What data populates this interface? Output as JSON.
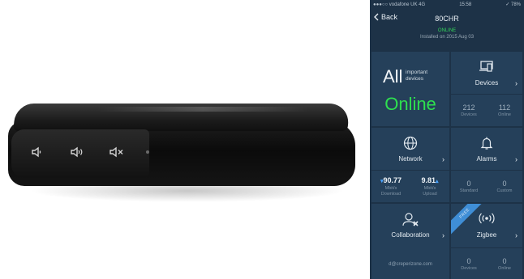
{
  "phone": {
    "status_bar": {
      "carrier": "●●●○○ vodafone UK  4G",
      "time": "15:58",
      "battery": "✓ 78%"
    },
    "nav": {
      "back_label": "Back",
      "title": "80CHR"
    },
    "status": {
      "state": "ONLINE",
      "installed": "Installed on 2015 Aug 03"
    },
    "summary": {
      "all": "All",
      "important_line1": "important",
      "important_line2": "devices",
      "online": "Online"
    },
    "devices": {
      "title": "Devices",
      "count_a": "212",
      "label_a": "Devices",
      "count_b": "112",
      "label_b": "Online"
    },
    "network": {
      "title": "Network",
      "down_val": "90.77",
      "down_label_1": "Mbit/s",
      "down_label_2": "Download",
      "up_val": "9.81",
      "up_label_1": "Mbit/s",
      "up_label_2": "Upload"
    },
    "alarms": {
      "title": "Alarms",
      "count_a": "0",
      "label_a": "Standard",
      "count_b": "0",
      "label_b": "Custom"
    },
    "collaboration": {
      "title": "Collaboration",
      "email": "d@creperizone.com",
      "ribbon": "FREE"
    },
    "zigbee": {
      "title": "Zigbee",
      "count_a": "0",
      "label_a": "Devices",
      "count_b": "0",
      "label_b": "Online"
    },
    "chevron": "›"
  },
  "colors": {
    "bg": "#1d3247",
    "tile": "#25405a",
    "online_green": "#2ee04f",
    "ribbon_blue": "#3f8ed6"
  },
  "icons": [
    "speaker-icon",
    "volume-icon",
    "mute-icon",
    "devices-icon",
    "globe-icon",
    "bell-icon",
    "collaboration-icon",
    "zigbee-icon",
    "back-chevron-icon"
  ]
}
